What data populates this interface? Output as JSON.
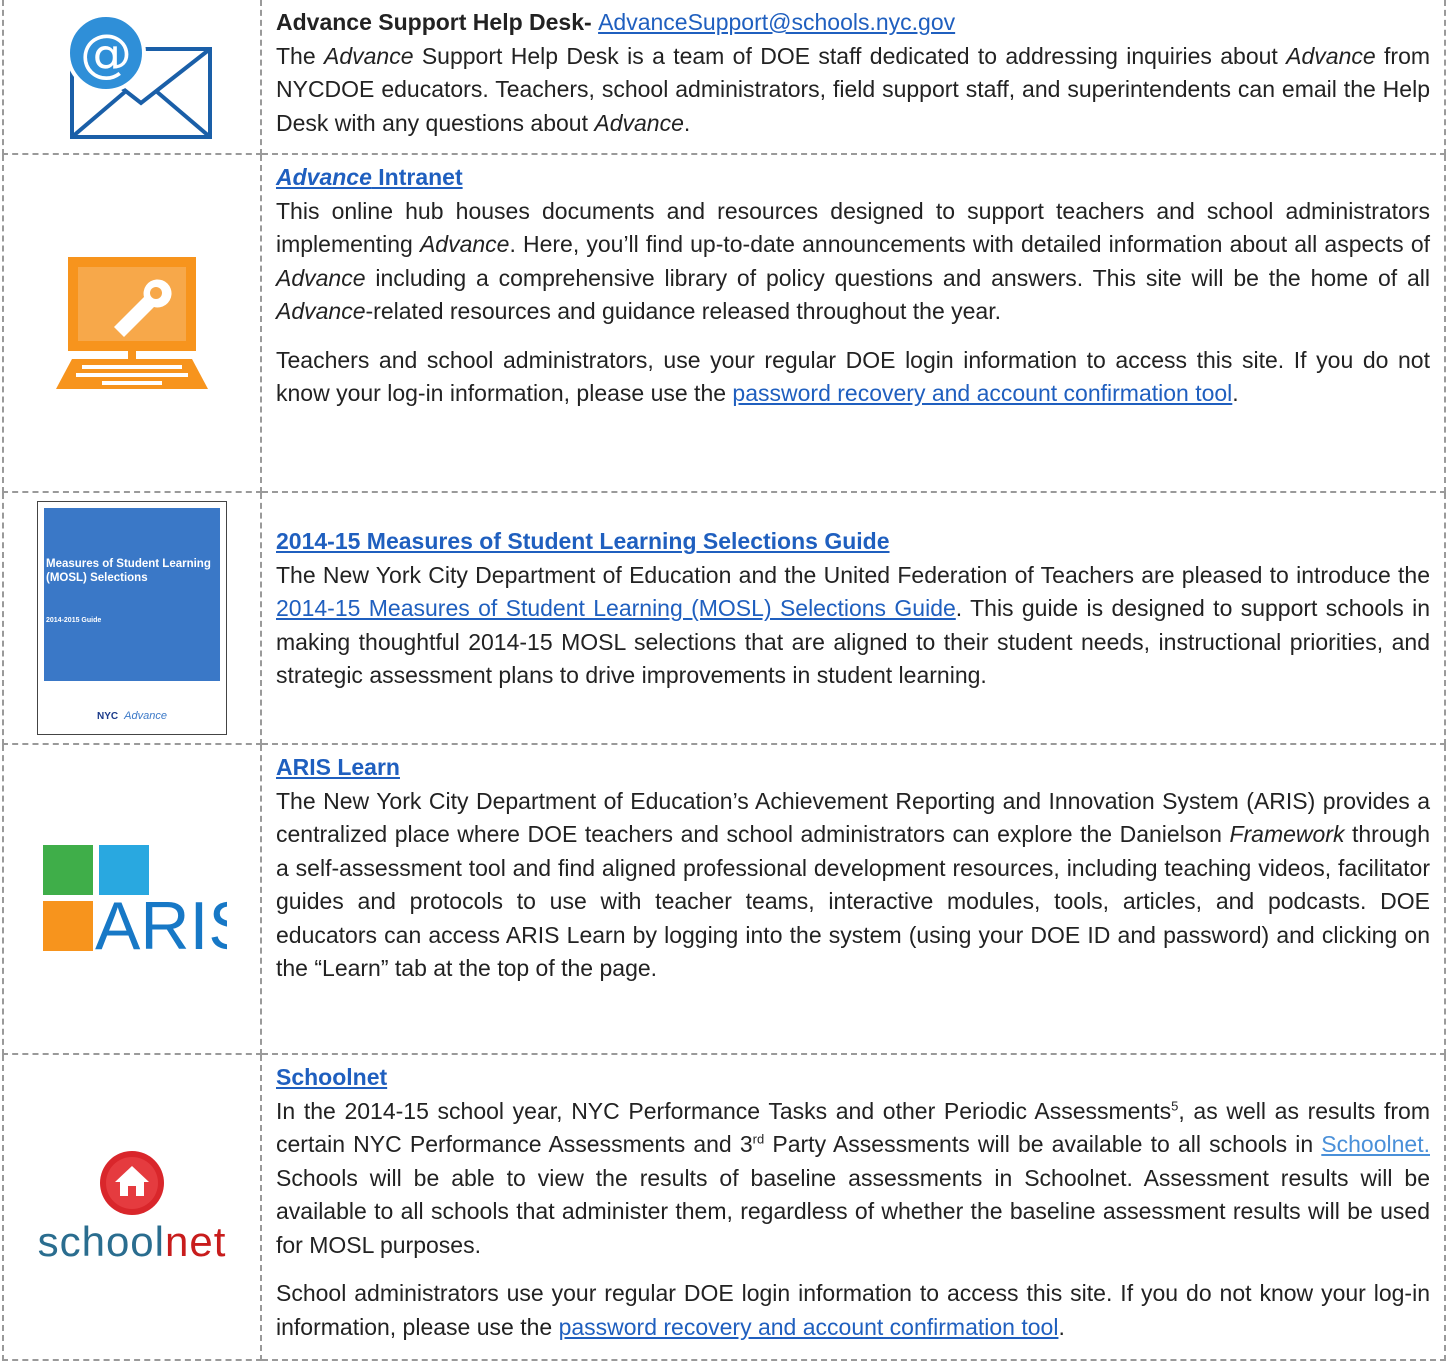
{
  "rows": [
    {
      "icon": "email-at-icon",
      "title": "Advance Support Help Desk- ",
      "title_link": "AdvanceSupport@schools.nyc.gov",
      "p1_a": "The ",
      "p1_b": "Advance",
      "p1_c": " Support Help Desk is a team of DOE staff dedicated to addressing inquiries about ",
      "p1_d": "Advance",
      "p1_e": " from NYCDOE educators. Teachers, school administrators, field support staff, and superintendents can email the Help Desk with any questions about ",
      "p1_f": "Advance",
      "p1_g": "."
    },
    {
      "icon": "computer-wrench-icon",
      "title_a": "Advance",
      "title_b": " Intranet",
      "p1_a": "This online hub houses documents and resources designed to support teachers and school administrators implementing ",
      "p1_b": "Advance",
      "p1_c": ".  Here, you’ll find up-to-date announcements with detailed information about all aspects of ",
      "p1_d": "Advance",
      "p1_e": " including a comprehensive library of policy questions and answers. This site will be the home of all ",
      "p1_f": "Advance",
      "p1_g": "-related resources and guidance released throughout the year.",
      "p2_a": "Teachers and school administrators, use your regular DOE login information to access this site.  If you do not know your log-in information, please use the ",
      "p2_link": "password recovery and account confirmation tool",
      "p2_b": "."
    },
    {
      "icon": "mosl-guide-cover",
      "cover_title": "Measures of Student Learning (MOSL) Selections",
      "cover_subtitle": "2014-2015 Guide",
      "cover_logo": "NYC",
      "cover_brand": "Advance",
      "title_link": "2014-15 Measures of Student Learning Selections Guide",
      "p1_a": "The New York City Department of Education and the United Federation of Teachers are pleased to introduce the ",
      "p1_link": "2014-15 Measures of Student Learning (MOSL) Selections Guide",
      "p1_b": ". This guide is designed to support schools in making thoughtful 2014-15 MOSL selections that are aligned to their student needs, instructional priorities, and strategic assessment plans to drive improvements in student learning."
    },
    {
      "icon": "aris-logo",
      "logo_text": "ARIS",
      "title_link": "ARIS Learn",
      "p1_a": "The New York City Department of Education’s Achievement Reporting and Innovation System (ARIS) provides a centralized place where DOE teachers and school administrators can explore the Danielson ",
      "p1_b": "Framework",
      "p1_c": " through a self-assessment tool and find aligned professional development resources, including teaching videos, facilitator guides and protocols to use with teacher teams, interactive modules, tools, articles, and podcasts. DOE educators can access ARIS Learn by logging into the system (using your DOE ID and password) and clicking on the “Learn” tab at the top of the page."
    },
    {
      "icon": "schoolnet-logo",
      "logo_a": "school",
      "logo_b": "net",
      "title_link": "Schoolnet",
      "p1_a": "In the 2014-15 school year, NYC Performance Tasks and other Periodic Assessments",
      "p1_sup1": "5",
      "p1_b": ", as well as results from certain NYC Performance Assessments and 3",
      "p1_sup2": "rd",
      "p1_c": " Party Assessments will be available to all schools in ",
      "p1_link": "Schoolnet.",
      "p1_d": " Schools will be able to view the results of baseline assessments in Schoolnet. Assessment results will be available to all schools that administer them, regardless of whether the baseline assessment results will be used for MOSL purposes.",
      "p2_a": "School administrators use your regular DOE login information to access this site.  If you do not know your log-in information, please use the ",
      "p2_link": "password recovery and account confirmation tool",
      "p2_b": "."
    }
  ],
  "colors": {
    "link": "#1f5fbf",
    "border": "#9a9a9a",
    "orange": "#f7941d",
    "aris_blue": "#1778c6",
    "schoolnet_red": "#c81c1c"
  }
}
